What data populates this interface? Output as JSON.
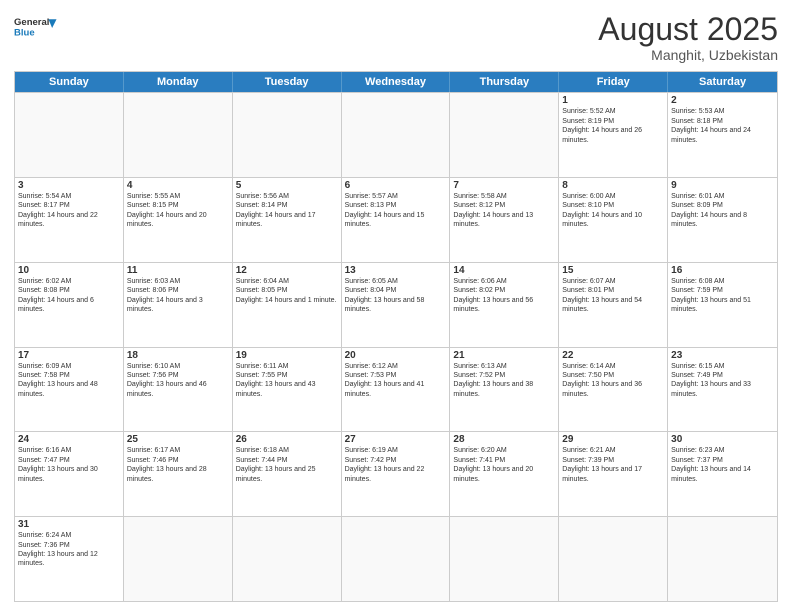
{
  "header": {
    "logo_general": "General",
    "logo_blue": "Blue",
    "month_title": "August 2025",
    "location": "Manghit, Uzbekistan"
  },
  "weekdays": [
    "Sunday",
    "Monday",
    "Tuesday",
    "Wednesday",
    "Thursday",
    "Friday",
    "Saturday"
  ],
  "rows": [
    [
      {
        "day": "",
        "info": ""
      },
      {
        "day": "",
        "info": ""
      },
      {
        "day": "",
        "info": ""
      },
      {
        "day": "",
        "info": ""
      },
      {
        "day": "",
        "info": ""
      },
      {
        "day": "1",
        "info": "Sunrise: 5:52 AM\nSunset: 8:19 PM\nDaylight: 14 hours and 26 minutes."
      },
      {
        "day": "2",
        "info": "Sunrise: 5:53 AM\nSunset: 8:18 PM\nDaylight: 14 hours and 24 minutes."
      }
    ],
    [
      {
        "day": "3",
        "info": "Sunrise: 5:54 AM\nSunset: 8:17 PM\nDaylight: 14 hours and 22 minutes."
      },
      {
        "day": "4",
        "info": "Sunrise: 5:55 AM\nSunset: 8:15 PM\nDaylight: 14 hours and 20 minutes."
      },
      {
        "day": "5",
        "info": "Sunrise: 5:56 AM\nSunset: 8:14 PM\nDaylight: 14 hours and 17 minutes."
      },
      {
        "day": "6",
        "info": "Sunrise: 5:57 AM\nSunset: 8:13 PM\nDaylight: 14 hours and 15 minutes."
      },
      {
        "day": "7",
        "info": "Sunrise: 5:58 AM\nSunset: 8:12 PM\nDaylight: 14 hours and 13 minutes."
      },
      {
        "day": "8",
        "info": "Sunrise: 6:00 AM\nSunset: 8:10 PM\nDaylight: 14 hours and 10 minutes."
      },
      {
        "day": "9",
        "info": "Sunrise: 6:01 AM\nSunset: 8:09 PM\nDaylight: 14 hours and 8 minutes."
      }
    ],
    [
      {
        "day": "10",
        "info": "Sunrise: 6:02 AM\nSunset: 8:08 PM\nDaylight: 14 hours and 6 minutes."
      },
      {
        "day": "11",
        "info": "Sunrise: 6:03 AM\nSunset: 8:06 PM\nDaylight: 14 hours and 3 minutes."
      },
      {
        "day": "12",
        "info": "Sunrise: 6:04 AM\nSunset: 8:05 PM\nDaylight: 14 hours and 1 minute."
      },
      {
        "day": "13",
        "info": "Sunrise: 6:05 AM\nSunset: 8:04 PM\nDaylight: 13 hours and 58 minutes."
      },
      {
        "day": "14",
        "info": "Sunrise: 6:06 AM\nSunset: 8:02 PM\nDaylight: 13 hours and 56 minutes."
      },
      {
        "day": "15",
        "info": "Sunrise: 6:07 AM\nSunset: 8:01 PM\nDaylight: 13 hours and 54 minutes."
      },
      {
        "day": "16",
        "info": "Sunrise: 6:08 AM\nSunset: 7:59 PM\nDaylight: 13 hours and 51 minutes."
      }
    ],
    [
      {
        "day": "17",
        "info": "Sunrise: 6:09 AM\nSunset: 7:58 PM\nDaylight: 13 hours and 48 minutes."
      },
      {
        "day": "18",
        "info": "Sunrise: 6:10 AM\nSunset: 7:56 PM\nDaylight: 13 hours and 46 minutes."
      },
      {
        "day": "19",
        "info": "Sunrise: 6:11 AM\nSunset: 7:55 PM\nDaylight: 13 hours and 43 minutes."
      },
      {
        "day": "20",
        "info": "Sunrise: 6:12 AM\nSunset: 7:53 PM\nDaylight: 13 hours and 41 minutes."
      },
      {
        "day": "21",
        "info": "Sunrise: 6:13 AM\nSunset: 7:52 PM\nDaylight: 13 hours and 38 minutes."
      },
      {
        "day": "22",
        "info": "Sunrise: 6:14 AM\nSunset: 7:50 PM\nDaylight: 13 hours and 36 minutes."
      },
      {
        "day": "23",
        "info": "Sunrise: 6:15 AM\nSunset: 7:49 PM\nDaylight: 13 hours and 33 minutes."
      }
    ],
    [
      {
        "day": "24",
        "info": "Sunrise: 6:16 AM\nSunset: 7:47 PM\nDaylight: 13 hours and 30 minutes."
      },
      {
        "day": "25",
        "info": "Sunrise: 6:17 AM\nSunset: 7:46 PM\nDaylight: 13 hours and 28 minutes."
      },
      {
        "day": "26",
        "info": "Sunrise: 6:18 AM\nSunset: 7:44 PM\nDaylight: 13 hours and 25 minutes."
      },
      {
        "day": "27",
        "info": "Sunrise: 6:19 AM\nSunset: 7:42 PM\nDaylight: 13 hours and 22 minutes."
      },
      {
        "day": "28",
        "info": "Sunrise: 6:20 AM\nSunset: 7:41 PM\nDaylight: 13 hours and 20 minutes."
      },
      {
        "day": "29",
        "info": "Sunrise: 6:21 AM\nSunset: 7:39 PM\nDaylight: 13 hours and 17 minutes."
      },
      {
        "day": "30",
        "info": "Sunrise: 6:23 AM\nSunset: 7:37 PM\nDaylight: 13 hours and 14 minutes."
      }
    ],
    [
      {
        "day": "31",
        "info": "Sunrise: 6:24 AM\nSunset: 7:36 PM\nDaylight: 13 hours and 12 minutes."
      },
      {
        "day": "",
        "info": ""
      },
      {
        "day": "",
        "info": ""
      },
      {
        "day": "",
        "info": ""
      },
      {
        "day": "",
        "info": ""
      },
      {
        "day": "",
        "info": ""
      },
      {
        "day": "",
        "info": ""
      }
    ]
  ]
}
